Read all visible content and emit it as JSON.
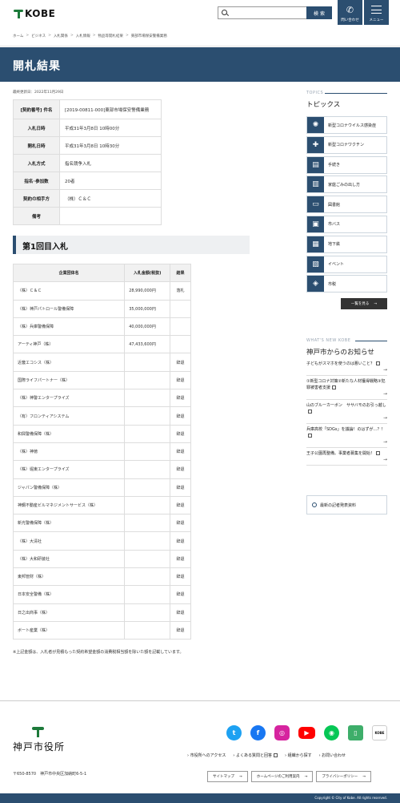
{
  "header": {
    "logo_text": "KOBE",
    "search_placeholder": "",
    "search_button": "検 索",
    "contact_label": "問い合わせ",
    "menu_label": "メニュー"
  },
  "breadcrumbs": [
    "ホーム",
    "ビジネス",
    "入札関係",
    "入札情報",
    "物品等開札結果",
    "東部市場保安警備業務"
  ],
  "page_title": "開札結果",
  "updated": "最終更新日：2022年11月29日",
  "info_table": [
    {
      "key": "[契約番号] 件名",
      "value": "[2019-00811-000]東部市場保安警備業務"
    },
    {
      "key": "入札日時",
      "value": "平成31年3月8日 10時00分"
    },
    {
      "key": "開札日時",
      "value": "平成31年3月8日 10時30分"
    },
    {
      "key": "入札方式",
      "value": "指名競争入札"
    },
    {
      "key": "指名･参加数",
      "value": "20者"
    },
    {
      "key": "契約の相手方",
      "value": "（株）Ｃ＆Ｃ"
    },
    {
      "key": "備考",
      "value": ""
    }
  ],
  "round_title": "第1回目入札",
  "bids_header": {
    "company": "企業団体名",
    "amount": "入札金額(税抜)",
    "result": "結果"
  },
  "bids": [
    {
      "company": "（株）Ｃ＆Ｃ",
      "amount": "28,990,000円",
      "result": "落札"
    },
    {
      "company": "（株）神戸パトロール警備保障",
      "amount": "35,000,000円",
      "result": ""
    },
    {
      "company": "（株）兵庫警備保障",
      "amount": "40,000,000円",
      "result": ""
    },
    {
      "company": "アーティ神戸（株）",
      "amount": "47,433,600円",
      "result": ""
    },
    {
      "company": "近畿エコシス（株）",
      "amount": "",
      "result": "辞退"
    },
    {
      "company": "国際ライフパートナー（株）",
      "amount": "",
      "result": "辞退"
    },
    {
      "company": "（株）神警エンタープライズ",
      "amount": "",
      "result": "辞退"
    },
    {
      "company": "（有）フロンティアシステム",
      "amount": "",
      "result": "辞退"
    },
    {
      "company": "和興警備保障（株）",
      "amount": "",
      "result": "辞退"
    },
    {
      "company": "（株）神徳",
      "amount": "",
      "result": "辞退"
    },
    {
      "company": "（株）堀東エンタープライズ",
      "amount": "",
      "result": "辞退"
    },
    {
      "company": "ジャパン警備保障（株）",
      "amount": "",
      "result": "辞退"
    },
    {
      "company": "神鋼不動産ビルマネジメントサービス（株）",
      "amount": "",
      "result": "辞退"
    },
    {
      "company": "新光警備保障（株）",
      "amount": "",
      "result": "辞退"
    },
    {
      "company": "（株）大清社",
      "amount": "",
      "result": "辞退"
    },
    {
      "company": "（株）大和研装社",
      "amount": "",
      "result": "辞退"
    },
    {
      "company": "東邦管財（株）",
      "amount": "",
      "result": "辞退"
    },
    {
      "company": "日本安全警備（株）",
      "amount": "",
      "result": "辞退"
    },
    {
      "company": "日之出商事（株）",
      "amount": "",
      "result": "辞退"
    },
    {
      "company": "ボート産業（株）",
      "amount": "",
      "result": "辞退"
    }
  ],
  "note": "※上記金額は、入札者が見積もった契約希望金額の消費税相当額を除いた額を記載しています。",
  "sidebar": {
    "topics_en": "TOPICS",
    "topics_jp": "トピックス",
    "topics": [
      {
        "label": "新型コロナウイルス感染症",
        "icon": "virus-icon"
      },
      {
        "label": "新型コロナワクチン",
        "icon": "vaccine-icon"
      },
      {
        "label": "手続き",
        "icon": "form-icon"
      },
      {
        "label": "家庭ごみの出し方",
        "icon": "trash-icon"
      },
      {
        "label": "図書館",
        "icon": "book-icon"
      },
      {
        "label": "市バス",
        "icon": "bus-icon"
      },
      {
        "label": "地下鉄",
        "icon": "train-icon"
      },
      {
        "label": "イベント",
        "icon": "calendar-icon"
      },
      {
        "label": "市税",
        "icon": "tax-icon"
      }
    ],
    "more_label": "一覧を見る",
    "new_en": "WHAT'S NEW KOBE",
    "new_jp": "神戸市からのお知らせ",
    "news": [
      {
        "text": "子どもがスマホを使うのは悪いこと？"
      },
      {
        "text": "①新型コロナ対策②新たな人材獲得戦略③犯罪被害者支援"
      },
      {
        "text": "山のブルーカーボン　ササバモのお引っ越し"
      },
      {
        "text": "兵庫高校「SDGs」を議論！のはずが…？！"
      },
      {
        "text": "王子公園再整備。事業者募集を開始！"
      }
    ],
    "press_label": "最新の記者発表資料"
  },
  "footer": {
    "city_name": "神戸市役所",
    "address": "〒650-8570　神戸市中央区加納町6-5-1",
    "links": [
      "市役所へのアクセス",
      "よくある質問と回答",
      "組織から探す",
      "お問い合わせ"
    ],
    "buttons": [
      "サイトマップ",
      "ホームページのご利用案内",
      "プライバシーポリシー"
    ],
    "copyright": "Copyright © City of Kobe. All rights reserved.",
    "social": [
      "twitter-icon",
      "facebook-icon",
      "instagram-icon",
      "youtube-icon",
      "line-icon",
      "bookmark-icon",
      "kobe-app-icon"
    ],
    "kobe_badge": "KOBE"
  },
  "colors": {
    "brand": "#2b4e70",
    "logo_green": "#1d7a3a"
  }
}
